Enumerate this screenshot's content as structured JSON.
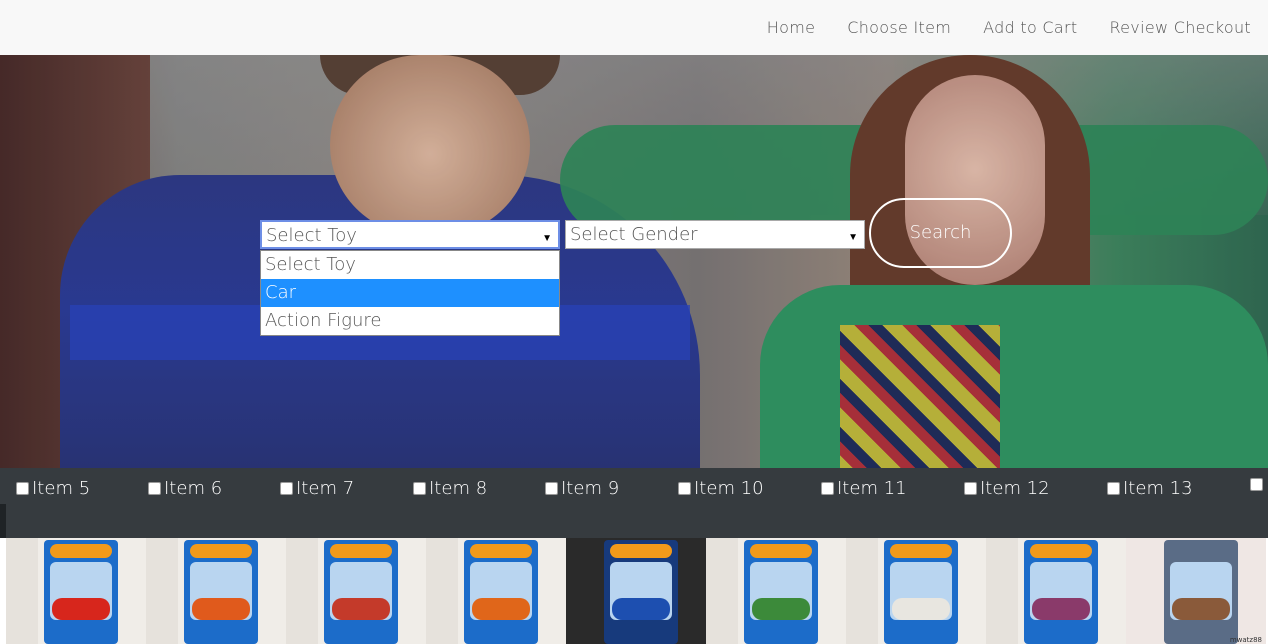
{
  "nav": {
    "links": [
      "Home",
      "Choose Item",
      "Add to Cart",
      "Review Checkout"
    ]
  },
  "search_form": {
    "toy_select": {
      "selected": "Select Toy",
      "options": [
        "Select Toy",
        "Car",
        "Action Figure"
      ],
      "highlighted": "Car"
    },
    "gender_select": {
      "selected": "Select Gender"
    },
    "search_label": "Search"
  },
  "items": [
    {
      "label": "Item 5"
    },
    {
      "label": "Item 6"
    },
    {
      "label": "Item 7"
    },
    {
      "label": "Item 8"
    },
    {
      "label": "Item 9"
    },
    {
      "label": "Item 10"
    },
    {
      "label": "Item 11"
    },
    {
      "label": "Item 12"
    },
    {
      "label": "Item 13"
    }
  ],
  "product_images": [
    {
      "name": "hot-wheels-red-car",
      "car_color": "#d7261c"
    },
    {
      "name": "hot-wheels-orange-car",
      "car_color": "#e05a1c"
    },
    {
      "name": "hot-wheels-red-muscle-car",
      "car_color": "#c43a2a"
    },
    {
      "name": "hot-wheels-orange-muscle-car",
      "car_color": "#e0661a"
    },
    {
      "name": "hot-wheels-blue-car",
      "car_color": "#1d4fb0"
    },
    {
      "name": "hot-wheels-green-car",
      "car_color": "#3c8a3a"
    },
    {
      "name": "hot-wheels-white-car",
      "car_color": "#e8e6e0"
    },
    {
      "name": "hot-wheels-purple-car",
      "car_color": "#8a3a6a"
    },
    {
      "name": "cars-mater-toy",
      "car_color": "#8a5a3a"
    }
  ],
  "watermark": "mwatz88",
  "colors": {
    "nav_bg": "#f8f8f8",
    "strip_bg": "#363b3f",
    "highlight": "#1e90ff"
  }
}
